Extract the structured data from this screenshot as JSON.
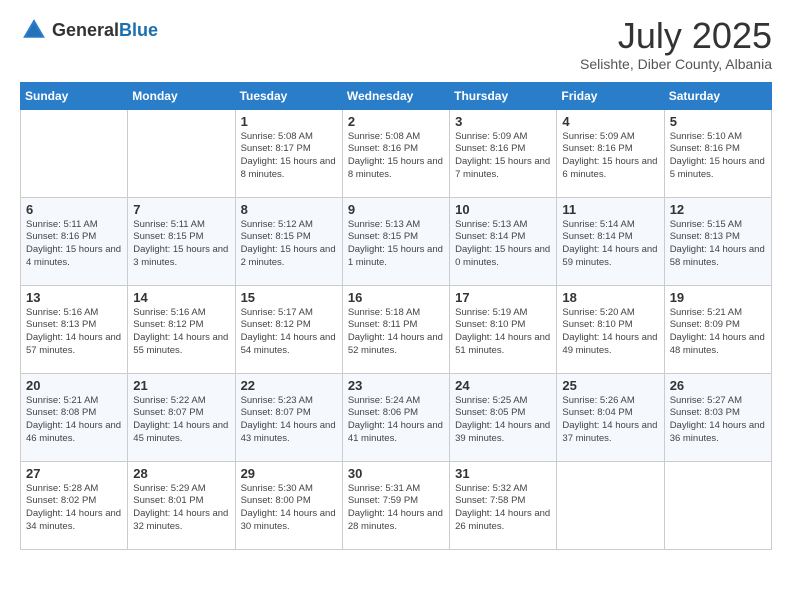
{
  "logo": {
    "general": "General",
    "blue": "Blue"
  },
  "title": {
    "month_year": "July 2025",
    "location": "Selishte, Diber County, Albania"
  },
  "headers": [
    "Sunday",
    "Monday",
    "Tuesday",
    "Wednesday",
    "Thursday",
    "Friday",
    "Saturday"
  ],
  "weeks": [
    [
      {
        "day": "",
        "info": ""
      },
      {
        "day": "",
        "info": ""
      },
      {
        "day": "1",
        "info": "Sunrise: 5:08 AM\nSunset: 8:17 PM\nDaylight: 15 hours and 8 minutes."
      },
      {
        "day": "2",
        "info": "Sunrise: 5:08 AM\nSunset: 8:16 PM\nDaylight: 15 hours and 8 minutes."
      },
      {
        "day": "3",
        "info": "Sunrise: 5:09 AM\nSunset: 8:16 PM\nDaylight: 15 hours and 7 minutes."
      },
      {
        "day": "4",
        "info": "Sunrise: 5:09 AM\nSunset: 8:16 PM\nDaylight: 15 hours and 6 minutes."
      },
      {
        "day": "5",
        "info": "Sunrise: 5:10 AM\nSunset: 8:16 PM\nDaylight: 15 hours and 5 minutes."
      }
    ],
    [
      {
        "day": "6",
        "info": "Sunrise: 5:11 AM\nSunset: 8:16 PM\nDaylight: 15 hours and 4 minutes."
      },
      {
        "day": "7",
        "info": "Sunrise: 5:11 AM\nSunset: 8:15 PM\nDaylight: 15 hours and 3 minutes."
      },
      {
        "day": "8",
        "info": "Sunrise: 5:12 AM\nSunset: 8:15 PM\nDaylight: 15 hours and 2 minutes."
      },
      {
        "day": "9",
        "info": "Sunrise: 5:13 AM\nSunset: 8:15 PM\nDaylight: 15 hours and 1 minute."
      },
      {
        "day": "10",
        "info": "Sunrise: 5:13 AM\nSunset: 8:14 PM\nDaylight: 15 hours and 0 minutes."
      },
      {
        "day": "11",
        "info": "Sunrise: 5:14 AM\nSunset: 8:14 PM\nDaylight: 14 hours and 59 minutes."
      },
      {
        "day": "12",
        "info": "Sunrise: 5:15 AM\nSunset: 8:13 PM\nDaylight: 14 hours and 58 minutes."
      }
    ],
    [
      {
        "day": "13",
        "info": "Sunrise: 5:16 AM\nSunset: 8:13 PM\nDaylight: 14 hours and 57 minutes."
      },
      {
        "day": "14",
        "info": "Sunrise: 5:16 AM\nSunset: 8:12 PM\nDaylight: 14 hours and 55 minutes."
      },
      {
        "day": "15",
        "info": "Sunrise: 5:17 AM\nSunset: 8:12 PM\nDaylight: 14 hours and 54 minutes."
      },
      {
        "day": "16",
        "info": "Sunrise: 5:18 AM\nSunset: 8:11 PM\nDaylight: 14 hours and 52 minutes."
      },
      {
        "day": "17",
        "info": "Sunrise: 5:19 AM\nSunset: 8:10 PM\nDaylight: 14 hours and 51 minutes."
      },
      {
        "day": "18",
        "info": "Sunrise: 5:20 AM\nSunset: 8:10 PM\nDaylight: 14 hours and 49 minutes."
      },
      {
        "day": "19",
        "info": "Sunrise: 5:21 AM\nSunset: 8:09 PM\nDaylight: 14 hours and 48 minutes."
      }
    ],
    [
      {
        "day": "20",
        "info": "Sunrise: 5:21 AM\nSunset: 8:08 PM\nDaylight: 14 hours and 46 minutes."
      },
      {
        "day": "21",
        "info": "Sunrise: 5:22 AM\nSunset: 8:07 PM\nDaylight: 14 hours and 45 minutes."
      },
      {
        "day": "22",
        "info": "Sunrise: 5:23 AM\nSunset: 8:07 PM\nDaylight: 14 hours and 43 minutes."
      },
      {
        "day": "23",
        "info": "Sunrise: 5:24 AM\nSunset: 8:06 PM\nDaylight: 14 hours and 41 minutes."
      },
      {
        "day": "24",
        "info": "Sunrise: 5:25 AM\nSunset: 8:05 PM\nDaylight: 14 hours and 39 minutes."
      },
      {
        "day": "25",
        "info": "Sunrise: 5:26 AM\nSunset: 8:04 PM\nDaylight: 14 hours and 37 minutes."
      },
      {
        "day": "26",
        "info": "Sunrise: 5:27 AM\nSunset: 8:03 PM\nDaylight: 14 hours and 36 minutes."
      }
    ],
    [
      {
        "day": "27",
        "info": "Sunrise: 5:28 AM\nSunset: 8:02 PM\nDaylight: 14 hours and 34 minutes."
      },
      {
        "day": "28",
        "info": "Sunrise: 5:29 AM\nSunset: 8:01 PM\nDaylight: 14 hours and 32 minutes."
      },
      {
        "day": "29",
        "info": "Sunrise: 5:30 AM\nSunset: 8:00 PM\nDaylight: 14 hours and 30 minutes."
      },
      {
        "day": "30",
        "info": "Sunrise: 5:31 AM\nSunset: 7:59 PM\nDaylight: 14 hours and 28 minutes."
      },
      {
        "day": "31",
        "info": "Sunrise: 5:32 AM\nSunset: 7:58 PM\nDaylight: 14 hours and 26 minutes."
      },
      {
        "day": "",
        "info": ""
      },
      {
        "day": "",
        "info": ""
      }
    ]
  ]
}
